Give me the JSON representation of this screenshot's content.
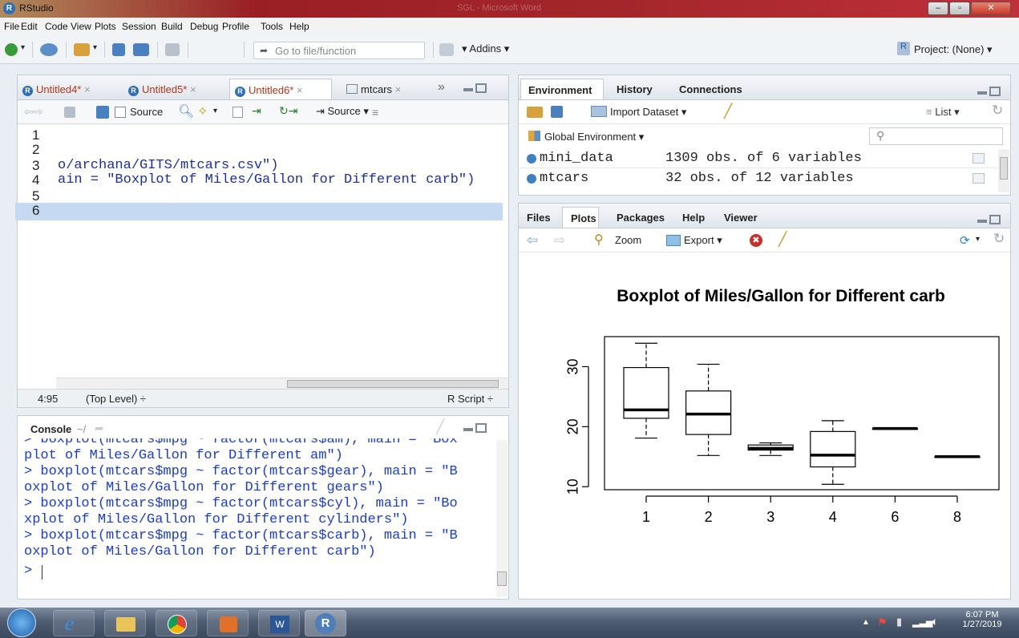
{
  "window": {
    "app_title": "RStudio",
    "center_title": "SGL - Microsoft Word"
  },
  "menu": [
    "File",
    "Edit",
    "Code",
    "View",
    "Plots",
    "Session",
    "Build",
    "Debug",
    "Profile",
    "Tools",
    "Help"
  ],
  "toolbar": {
    "goto_placeholder": "Go to file/function",
    "addins_label": "Addins",
    "project_label": "Project: (None)"
  },
  "editor": {
    "tabs": [
      "Untitled4*",
      "Untitled5*",
      "Untitled6*",
      "mtcars"
    ],
    "source_on_save_label": "Source",
    "source_button_label": "Source",
    "line_numbers": [
      "1",
      "2",
      "3",
      "4",
      "5",
      "6"
    ],
    "code_lines": [
      "",
      "",
      "o/archana/GITS/mtcars.csv\")",
      "ain = \"Boxplot of Miles/Gallon for Different carb\")",
      "",
      ""
    ],
    "status_position": "4:95",
    "status_scope": "(Top Level) ÷",
    "status_type": "R Script ÷"
  },
  "console": {
    "title": "Console",
    "path": "~/",
    "lines": [
      "> boxplot(mtcars$mpg ~ factor(mtcars$am), main = \"Box",
      "plot of Miles/Gallon for Different am\")",
      "> boxplot(mtcars$mpg ~ factor(mtcars$gear), main = \"B",
      "oxplot of Miles/Gallon for Different gears\")",
      "> boxplot(mtcars$mpg ~ factor(mtcars$cyl), main = \"Bo",
      "xplot of Miles/Gallon for Different cylinders\")",
      "> boxplot(mtcars$mpg ~ factor(mtcars$carb), main = \"B",
      "oxplot of Miles/Gallon for Different carb\")",
      ">"
    ]
  },
  "environment": {
    "tabs": [
      "Environment",
      "History",
      "Connections"
    ],
    "import_label": "Import Dataset",
    "list_label": "List",
    "scope_label": "Global Environment",
    "rows": [
      {
        "name": "mini_data",
        "value": "1309 obs. of 6 variables"
      },
      {
        "name": "mtcars",
        "value": "32 obs. of 12 variables"
      }
    ]
  },
  "plots": {
    "tabs": [
      "Files",
      "Plots",
      "Packages",
      "Help",
      "Viewer"
    ],
    "zoom_label": "Zoom",
    "export_label": "Export"
  },
  "chart_data": {
    "type": "boxplot",
    "title": "Boxplot of Miles/Gallon for Different carb",
    "xlabel": "",
    "ylabel": "",
    "categories": [
      "1",
      "2",
      "3",
      "4",
      "6",
      "8"
    ],
    "yticks": [
      "10",
      "20",
      "30"
    ],
    "ylim": [
      9.5,
      35
    ],
    "boxes": [
      {
        "category": "1",
        "min": 18.1,
        "q1": 21.4,
        "median": 22.8,
        "q3": 29.85,
        "max": 33.9
      },
      {
        "category": "2",
        "min": 15.2,
        "q1": 18.7,
        "median": 22.1,
        "q3": 25.95,
        "max": 30.4
      },
      {
        "category": "3",
        "min": 15.2,
        "q1": 16.1,
        "median": 16.4,
        "q3": 16.95,
        "max": 17.3
      },
      {
        "category": "4",
        "min": 10.4,
        "q1": 13.3,
        "median": 15.25,
        "q3": 19.2,
        "max": 21.0
      },
      {
        "category": "6",
        "min": 19.7,
        "q1": 19.7,
        "median": 19.7,
        "q3": 19.7,
        "max": 19.7
      },
      {
        "category": "8",
        "min": 15.0,
        "q1": 15.0,
        "median": 15.0,
        "q3": 15.0,
        "max": 15.0
      }
    ]
  },
  "taskbar": {
    "time": "6:07 PM",
    "date": "1/27/2019"
  }
}
